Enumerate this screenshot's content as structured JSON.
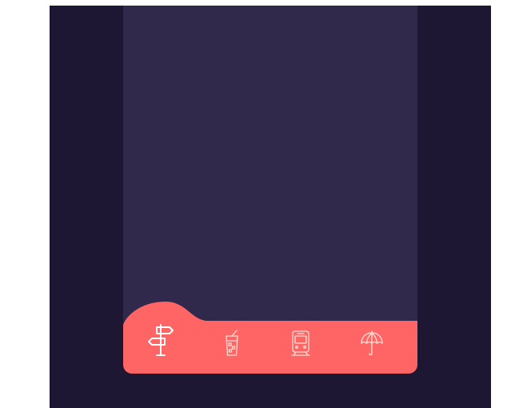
{
  "colors": {
    "page_background": "#ffffff",
    "frame_background": "#1d1734",
    "screen_background": "#30294c",
    "tabbar_background": "#ff6565",
    "icon_active": "#ffffff",
    "icon_inactive": "#ffe0d6"
  },
  "tabbar": {
    "active_index": 0,
    "tabs": [
      {
        "icon": "signpost-icon",
        "active": true
      },
      {
        "icon": "drink-glass-icon",
        "active": false
      },
      {
        "icon": "train-icon",
        "active": false
      },
      {
        "icon": "umbrella-icon",
        "active": false
      }
    ]
  }
}
